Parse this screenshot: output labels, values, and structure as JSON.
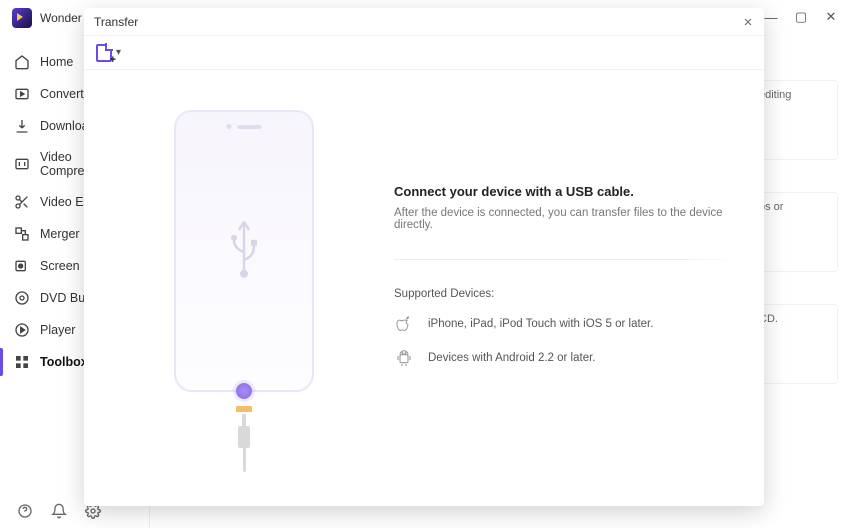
{
  "app": {
    "name": "Wonder"
  },
  "window_controls": {
    "min": "—",
    "max": "▢",
    "close": "✕"
  },
  "sidebar": {
    "items": [
      {
        "label": "Home"
      },
      {
        "label": "Converter"
      },
      {
        "label": "Downloader"
      },
      {
        "label": "Video Compressor"
      },
      {
        "label": "Video Editor"
      },
      {
        "label": "Merger"
      },
      {
        "label": "Screen Recorder"
      },
      {
        "label": "DVD Burner"
      },
      {
        "label": "Player"
      },
      {
        "label": "Toolbox"
      }
    ]
  },
  "bg_cards": {
    "c1": "editing",
    "c2": "os or",
    "c3": "CD."
  },
  "modal": {
    "title": "Transfer",
    "headline": "Connect your device with a USB cable.",
    "subline": "After the device is connected, you can transfer files to the device directly.",
    "supported_label": "Supported Devices:",
    "device_ios": "iPhone, iPad, iPod Touch with iOS 5 or later.",
    "device_android": "Devices with Android 2.2 or later."
  }
}
